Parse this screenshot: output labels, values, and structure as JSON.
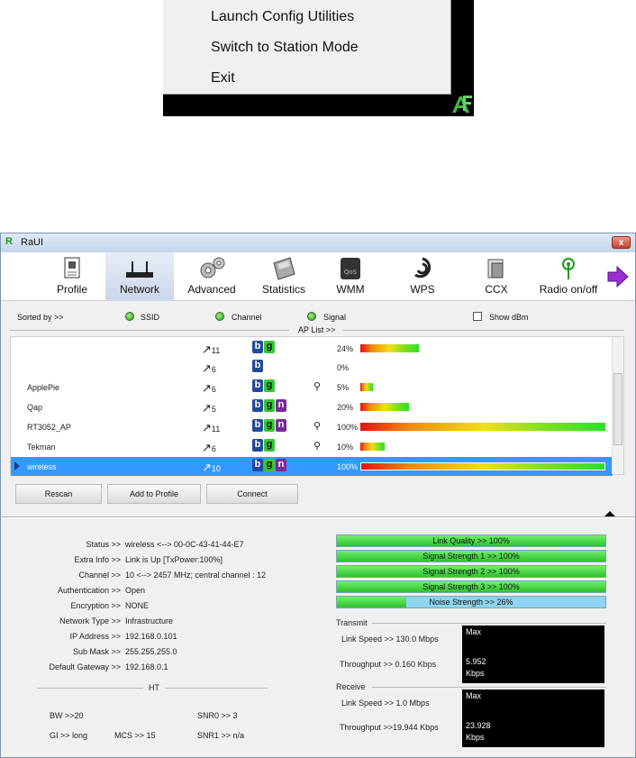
{
  "context_menu": {
    "items": [
      "Launch Config Utilities",
      "Switch to Station Mode",
      "Exit"
    ]
  },
  "window": {
    "title": "RaUI",
    "close_glyph": "x"
  },
  "toolbar": {
    "items": [
      "Profile",
      "Network",
      "Advanced",
      "Statistics",
      "WMM",
      "WPS",
      "CCX",
      "Radio on/off"
    ],
    "active": "Network"
  },
  "sort_bar": {
    "sorted_by": "Sorted by >>",
    "ssid": "SSID",
    "channel": "Channel",
    "signal": "Signal",
    "show_dbm": "Show dBm",
    "ap_list": "AP List >>"
  },
  "ap_list": [
    {
      "ssid": "",
      "channel": "11",
      "modes": [
        "b",
        "g"
      ],
      "secure": false,
      "signal": "24%",
      "level": 24
    },
    {
      "ssid": "",
      "channel": "6",
      "modes": [
        "b"
      ],
      "secure": false,
      "signal": "0%",
      "level": 0
    },
    {
      "ssid": "ApplePie",
      "channel": "6",
      "modes": [
        "b",
        "g"
      ],
      "secure": true,
      "signal": "5%",
      "level": 5
    },
    {
      "ssid": "Qap",
      "channel": "5",
      "modes": [
        "b",
        "g",
        "n"
      ],
      "secure": false,
      "signal": "20%",
      "level": 20
    },
    {
      "ssid": "RT3052_AP",
      "channel": "11",
      "modes": [
        "b",
        "g",
        "n"
      ],
      "secure": true,
      "signal": "100%",
      "level": 100
    },
    {
      "ssid": "Tekman",
      "channel": "6",
      "modes": [
        "b",
        "g"
      ],
      "secure": true,
      "signal": "10%",
      "level": 10
    },
    {
      "ssid": "wireless",
      "channel": "10",
      "modes": [
        "b",
        "g",
        "n"
      ],
      "secure": false,
      "signal": "100%",
      "level": 100,
      "selected": true
    }
  ],
  "buttons": {
    "rescan": "Rescan",
    "add_to_profile": "Add to Profile",
    "connect": "Connect"
  },
  "info": {
    "status_k": "Status >>",
    "status_v": "wireless <--> 00-0C-43-41-44-E7",
    "extra_k": "Extra Info >>",
    "extra_v": "Link is Up [TxPower:100%]",
    "channel_k": "Channel >>",
    "channel_v": "10 <--> 2457 MHz; central channel : 12",
    "auth_k": "Authentication >>",
    "auth_v": "Open",
    "enc_k": "Encryption >>",
    "enc_v": "NONE",
    "ntype_k": "Network Type >>",
    "ntype_v": "Infrastructure",
    "ip_k": "IP Address >>",
    "ip_v": "192.168.0.101",
    "mask_k": "Sub Mask >>",
    "mask_v": "255.255.255.0",
    "gw_k": "Default Gateway >>",
    "gw_v": "192.168.0.1"
  },
  "ht": {
    "title": "HT",
    "bw": "BW >>20",
    "gi": "GI >> long",
    "mcs": "MCS >>  15",
    "snr0": "SNR0 >>  3",
    "snr1": "SNR1 >>  n/a"
  },
  "meters": [
    {
      "label": "Link Quality >> 100%",
      "level": 100
    },
    {
      "label": "Signal Strength 1 >> 100%",
      "level": 100
    },
    {
      "label": "Signal Strength 2 >> 100%",
      "level": 100
    },
    {
      "label": "Signal Strength 3 >> 100%",
      "level": 100
    },
    {
      "label": "Noise Strength >> 26%",
      "level": 26
    }
  ],
  "transmit": {
    "title": "Transmit",
    "link_speed": "Link Speed >>  130.0 Mbps",
    "throughput": "Throughput >> 0.160 Kbps",
    "graph_max": "Max",
    "graph_value": "5.952",
    "graph_unit": "Kbps"
  },
  "receive": {
    "title": "Receive",
    "link_speed": "Link Speed >> 1.0 Mbps",
    "throughput": "Throughput >>19.944 Kbps",
    "graph_max": "Max",
    "graph_value": "23.928",
    "graph_unit": "Kbps"
  },
  "colors": {
    "selection": "#3399ff",
    "meter_fill": "#40d040",
    "graph_tx": "#22ee22",
    "graph_rx": "#f0f000"
  }
}
